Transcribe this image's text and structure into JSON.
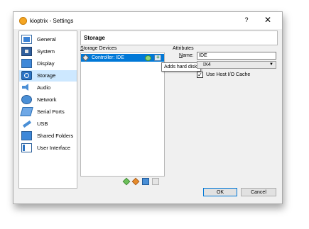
{
  "window": {
    "title": "kioptrix - Settings",
    "help": "?",
    "close": "✕"
  },
  "sidebar": {
    "items": [
      {
        "label": "General",
        "icon": "general-icon"
      },
      {
        "label": "System",
        "icon": "system-icon"
      },
      {
        "label": "Display",
        "icon": "display-icon"
      },
      {
        "label": "Storage",
        "icon": "storage-icon",
        "selected": true
      },
      {
        "label": "Audio",
        "icon": "audio-icon"
      },
      {
        "label": "Network",
        "icon": "network-icon"
      },
      {
        "label": "Serial Ports",
        "icon": "serial-ports-icon"
      },
      {
        "label": "USB",
        "icon": "usb-icon"
      },
      {
        "label": "Shared Folders",
        "icon": "shared-folders-icon"
      },
      {
        "label": "User Interface",
        "icon": "user-interface-icon"
      }
    ]
  },
  "page": {
    "title": "Storage"
  },
  "storage_devices": {
    "label_accel": "S",
    "label_rest": "torage Devices",
    "controller": "Controller: IDE",
    "tooltip": "Adds hard disk."
  },
  "attributes": {
    "label": "Attributes",
    "name_label_accel": "N",
    "name_label_rest": "ame:",
    "name_value": "IDE",
    "type_value": "IX4",
    "host_io_cache_label": "Use Host I/O Cache",
    "host_io_cache_checked": true
  },
  "buttons": {
    "ok": "OK",
    "cancel": "Cancel"
  },
  "colors": {
    "selection": "#0078d7",
    "sidebar_selected": "#cde8ff"
  }
}
